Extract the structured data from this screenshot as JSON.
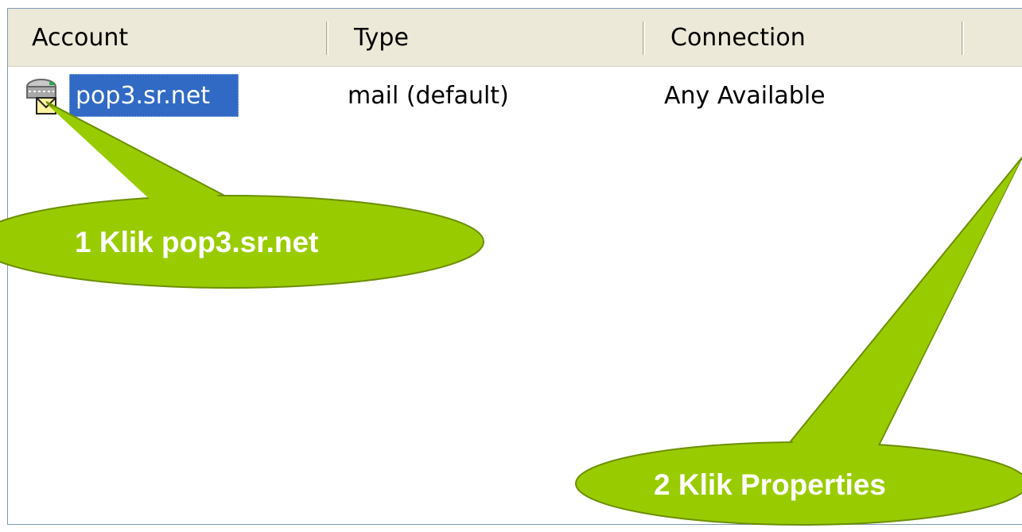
{
  "list_columns": [
    {
      "label": "Account"
    },
    {
      "label": "Type"
    },
    {
      "label": "Connection"
    }
  ],
  "accounts": [
    {
      "account": "pop3.sr.net",
      "type": "mail (default)",
      "connection": "Any Available",
      "icon": "mail-server-icon",
      "selected": true
    }
  ],
  "annotations": {
    "step1": "1 Klik pop3.sr.net",
    "step2": "2 Klik Properties"
  },
  "colors": {
    "callout_fill": "#99cc00",
    "selection": "#316ac5",
    "header_bg": "#ece9d8"
  }
}
